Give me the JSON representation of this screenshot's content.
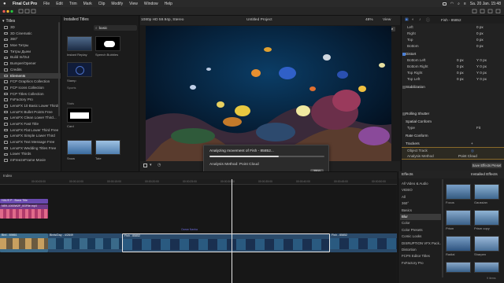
{
  "menubar": {
    "apple": "",
    "items": [
      "Final Cut Pro",
      "File",
      "Edit",
      "Trim",
      "Mark",
      "Clip",
      "Modify",
      "View",
      "Window",
      "Help"
    ],
    "datetime": "Sa. 20 Jan.  15:48"
  },
  "sidebar": {
    "root": "Titles",
    "items": [
      "3D",
      "3D Cinematic",
      "360°",
      "Mое Титры",
      "Титры Дыни",
      "Build In/Out",
      "Bumper/Opener",
      "Credits",
      "Elements",
      "FCP Graphics Collection",
      "FCP Icons Collection",
      "FCP Titles Collection",
      "FxFactory Pro",
      "LenoFX 10 Basic Lower Thirds",
      "LenoFX Bullet Points Free",
      "LenoFX Clean Lower Third...",
      "LenoFX Fast Title",
      "LenoFX Flat Lower Third Free",
      "LenoFX Simple Lower Third",
      "LenoFX Text Message Free",
      "LenoFX Wedding Titles Free",
      "Lower Thirds",
      "mFreezeFrame Movie"
    ],
    "selected_index": 8
  },
  "browser": {
    "title": "Installed Titles",
    "search_value": "basic",
    "thumbs": [
      {
        "label": "Instant Replay"
      },
      {
        "label": "Speech Bubbles"
      },
      {
        "label": "Stamp"
      },
      {
        "label": "Card"
      },
      {
        "label": "Snow"
      },
      {
        "label": "Tate"
      }
    ],
    "sections": [
      "Sports",
      "Stats"
    ]
  },
  "viewer": {
    "format": "1080p HD 59.94p, Stereo",
    "project": "Untitled Project",
    "zoom": "48%",
    "view_label": "View",
    "reset": "Reset",
    "done": "Done",
    "timecode": "00:00:03:00"
  },
  "dialog": {
    "line1": "Analyzing movement of Fish - 85852...",
    "progress": 0.6,
    "line2": "Analysis Method: Point Cloud",
    "stop": "Stop"
  },
  "inspector": {
    "title": "Fish - 85852",
    "rows": [
      {
        "label": "Left",
        "v1": "",
        "v2": "0 px"
      },
      {
        "label": "Right",
        "v1": "",
        "v2": "0 px"
      },
      {
        "label": "Top",
        "v1": "",
        "v2": "0 px"
      },
      {
        "label": "Bottom",
        "v1": "",
        "v2": "0 px"
      }
    ],
    "distort": "Distort",
    "distort_rows": [
      {
        "label": "Bottom Left",
        "v1": "0 px",
        "v2": "Y 0 px"
      },
      {
        "label": "Bottom Right",
        "v1": "0 px",
        "v2": "Y 0 px"
      },
      {
        "label": "Top Right",
        "v1": "0 px",
        "v2": "Y 0 px"
      },
      {
        "label": "Top Left",
        "v1": "0 px",
        "v2": "Y 0 px"
      }
    ],
    "stabilization": "Stabilization",
    "rolling_shutter": "Rolling Shutter",
    "spatial_conform": "Spatial Conform",
    "type_label": "Type",
    "type_value": "Fit",
    "rate_conform": "Rate Conform",
    "trackers": "Trackers",
    "object_track": "Object Track",
    "analysis_method": "Analysis Method",
    "analysis_value": "Point Cloud",
    "save_button": "Save Effects Preset"
  },
  "timeline": {
    "index": "Index",
    "ruler": [
      "00:00:05:00",
      "00:00:10:00",
      "00:00:15:00",
      "00:00:20:00",
      "00:00:25:00",
      "00:00:30:00",
      "00:00:35:00",
      "00:00:40:00",
      "00:00:45:00",
      "00:00:50:00"
    ],
    "clips": [
      {
        "label": "HAUS P - Basic Title"
      },
      {
        "label": "NEK-1000W2F_0GFile.mp4"
      },
      {
        "label": "Bird - 69861"
      },
      {
        "label": "Birds/Day - 4/2849"
      },
      {
        "label": "Fish - 85852"
      },
      {
        "label": "Fish - 85852"
      },
      {
        "label": "Ocean Nanba"
      }
    ]
  },
  "effects": {
    "title": "Effects",
    "installed": "Installed Effects",
    "categories": [
      "All Video & Audio",
      "VIDEO",
      "All",
      "360°",
      "Basics",
      "Blur",
      "Color",
      "Color Presets",
      "Comic Looks",
      "DISRUPTION VFX Pack...",
      "Distortion",
      "FCPX Editor Titles",
      "FxFactory Pro"
    ],
    "selected_index": 5,
    "thumbs": [
      {
        "label": "Focus"
      },
      {
        "label": "Gaussian"
      },
      {
        "label": "Prism"
      },
      {
        "label": "Prism copy"
      },
      {
        "label": "Radial"
      },
      {
        "label": "Sharpen"
      }
    ],
    "count": "9 items"
  }
}
